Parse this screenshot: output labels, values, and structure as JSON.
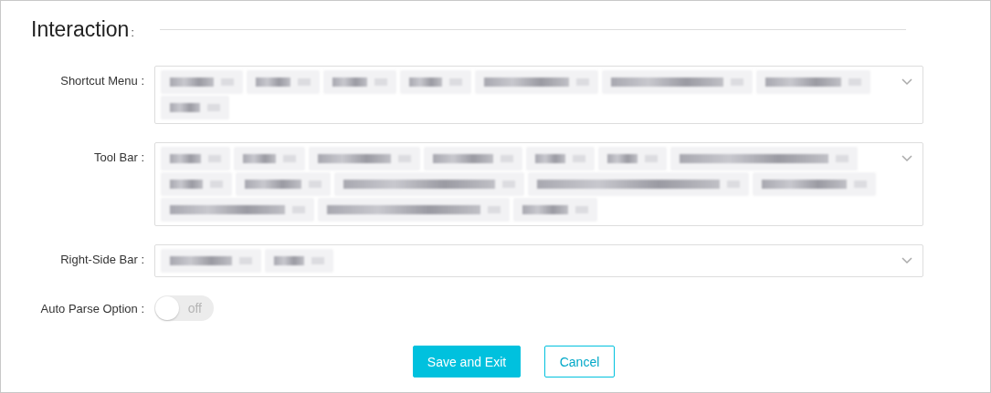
{
  "section": {
    "title": "Interaction",
    "colon": ":"
  },
  "fields": [
    {
      "label": "Shortcut Menu :",
      "tags": [
        {
          "kind": "blurred"
        },
        {
          "kind": "blurred"
        },
        {
          "kind": "blurred"
        },
        {
          "kind": "blurred"
        },
        {
          "kind": "blurred"
        },
        {
          "kind": "blurred"
        },
        {
          "kind": "blurred"
        },
        {
          "kind": "blurred"
        }
      ]
    },
    {
      "label": "Tool Bar :",
      "tags": [
        {
          "kind": "blurred"
        },
        {
          "kind": "blurred"
        },
        {
          "kind": "blurred"
        },
        {
          "kind": "blurred"
        },
        {
          "kind": "blurred"
        },
        {
          "kind": "blurred"
        },
        {
          "kind": "blurred"
        },
        {
          "kind": "blurred"
        },
        {
          "kind": "blurred"
        },
        {
          "kind": "blurred"
        },
        {
          "kind": "blurred"
        },
        {
          "kind": "blurred"
        },
        {
          "kind": "blurred"
        },
        {
          "kind": "blurred"
        },
        {
          "kind": "blurred"
        }
      ]
    },
    {
      "label": "Right-Side Bar :",
      "tags": [
        {
          "kind": "blurred"
        },
        {
          "kind": "blurred"
        }
      ]
    }
  ],
  "toggle": {
    "label": "Auto Parse Option :",
    "on": false,
    "text": "off"
  },
  "buttons": [
    {
      "label": "Save and Exit",
      "kind": "primary"
    },
    {
      "label": "Cancel",
      "kind": "secondary"
    }
  ]
}
